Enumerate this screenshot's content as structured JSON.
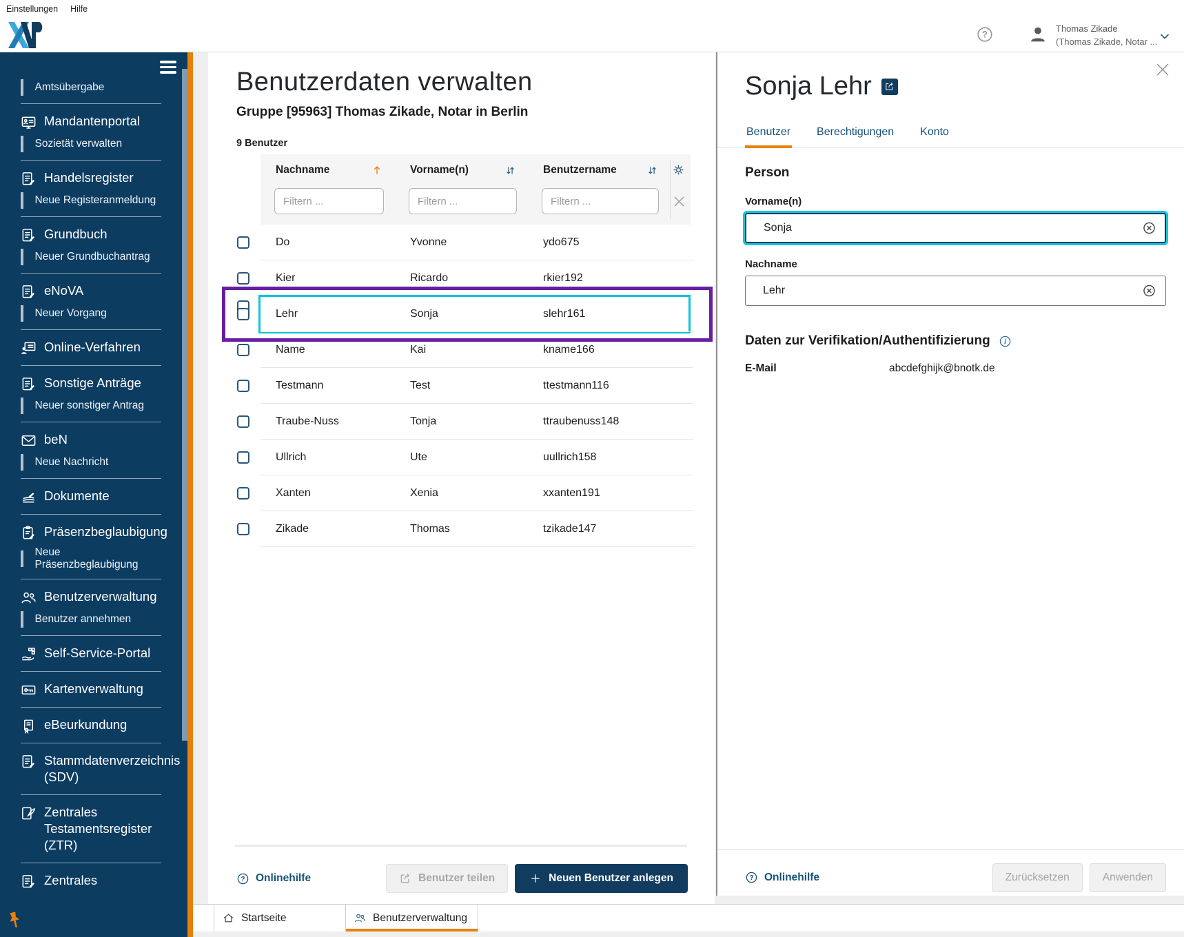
{
  "colors": {
    "accent_orange": "#e8800c",
    "navy": "#0d3c61",
    "selection_cyan": "#0bc4d8",
    "annotation_purple": "#681f9f"
  },
  "menubar": {
    "settings": "Einstellungen",
    "help": "Hilfe"
  },
  "header": {
    "logo": "XNP",
    "user_name": "Thomas Zikade",
    "user_org": "(Thomas Zikade, Notar ..."
  },
  "sidebar": {
    "sections": [
      {
        "title": "",
        "subitems": [
          "Amtsübergabe"
        ]
      },
      {
        "title": "Mandantenportal",
        "subitems": [
          "Sozietät verwalten"
        ]
      },
      {
        "title": "Handelsregister",
        "subitems": [
          "Neue Registeranmeldung"
        ]
      },
      {
        "title": "Grundbuch",
        "subitems": [
          "Neuer Grundbuchantrag"
        ]
      },
      {
        "title": "eNoVA",
        "subitems": [
          "Neuer Vorgang"
        ]
      },
      {
        "title": "Online-Verfahren",
        "subitems": []
      },
      {
        "title": "Sonstige Anträge",
        "subitems": [
          "Neuer sonstiger Antrag"
        ]
      },
      {
        "title": "beN",
        "subitems": [
          "Neue Nachricht"
        ]
      },
      {
        "title": "Dokumente",
        "subitems": []
      },
      {
        "title": "Präsenzbeglaubigung",
        "subitems": [
          "Neue Präsenzbeglaubigung"
        ]
      },
      {
        "title": "Benutzerverwaltung",
        "subitems": [
          "Benutzer annehmen"
        ]
      },
      {
        "title": "Self-Service-Portal",
        "subitems": []
      },
      {
        "title": "Kartenverwaltung",
        "subitems": []
      },
      {
        "title": "eBeurkundung",
        "subitems": []
      },
      {
        "title": "Stammdatenverzeichnis (SDV)",
        "subitems": []
      },
      {
        "title": "Zentrales Testamentsregister (ZTR)",
        "subitems": []
      },
      {
        "title": "Zentrales",
        "subitems": []
      }
    ]
  },
  "main": {
    "title": "Benutzerdaten verwalten",
    "subtitle": "Gruppe [95963] Thomas Zikade, Notar in Berlin",
    "count_label": "9 Benutzer",
    "table": {
      "columns": [
        "Nachname",
        "Vorname(n)",
        "Benutzername"
      ],
      "filter_placeholder": "Filtern ...",
      "rows": [
        {
          "nachname": "Do",
          "vorname": "Yvonne",
          "benutzername": "ydo675"
        },
        {
          "nachname": "Kier",
          "vorname": "Ricardo",
          "benutzername": "rkier192"
        },
        {
          "nachname": "Lehr",
          "vorname": "Sonja",
          "benutzername": "slehr161"
        },
        {
          "nachname": "Name",
          "vorname": "Kai",
          "benutzername": "kname166"
        },
        {
          "nachname": "Testmann",
          "vorname": "Test",
          "benutzername": "ttestmann116"
        },
        {
          "nachname": "Traube-Nuss",
          "vorname": "Tonja",
          "benutzername": "ttraubenuss148"
        },
        {
          "nachname": "Ullrich",
          "vorname": "Ute",
          "benutzername": "uullrich158"
        },
        {
          "nachname": "Xanten",
          "vorname": "Xenia",
          "benutzername": "xxanten191"
        },
        {
          "nachname": "Zikade",
          "vorname": "Thomas",
          "benutzername": "tzikade147"
        }
      ],
      "selected_row": "Lehr"
    },
    "footer": {
      "online_help": "Onlinehilfe",
      "share_button": "Benutzer teilen",
      "create_button": "Neuen Benutzer anlegen"
    }
  },
  "panel": {
    "title": "Sonja Lehr",
    "tabs": [
      {
        "label": "Benutzer"
      },
      {
        "label": "Berechtigungen"
      },
      {
        "label": "Konto"
      }
    ],
    "active_tab": "Benutzer",
    "person_heading": "Person",
    "vorname_label": "Vorname(n)",
    "vorname_value": "Sonja",
    "nachname_label": "Nachname",
    "nachname_value": "Lehr",
    "verification_heading": "Daten zur Verifikation/Authentifizierung",
    "email_label": "E-Mail",
    "email_value": "abcdefghijk@bnotk.de",
    "footer": {
      "online_help": "Onlinehilfe",
      "reset_button": "Zurücksetzen",
      "apply_button": "Anwenden"
    }
  },
  "taskbar": {
    "tabs": [
      {
        "label": "Startseite"
      },
      {
        "label": "Benutzerverwaltung"
      }
    ],
    "active_tab": "Benutzerverwaltung"
  }
}
